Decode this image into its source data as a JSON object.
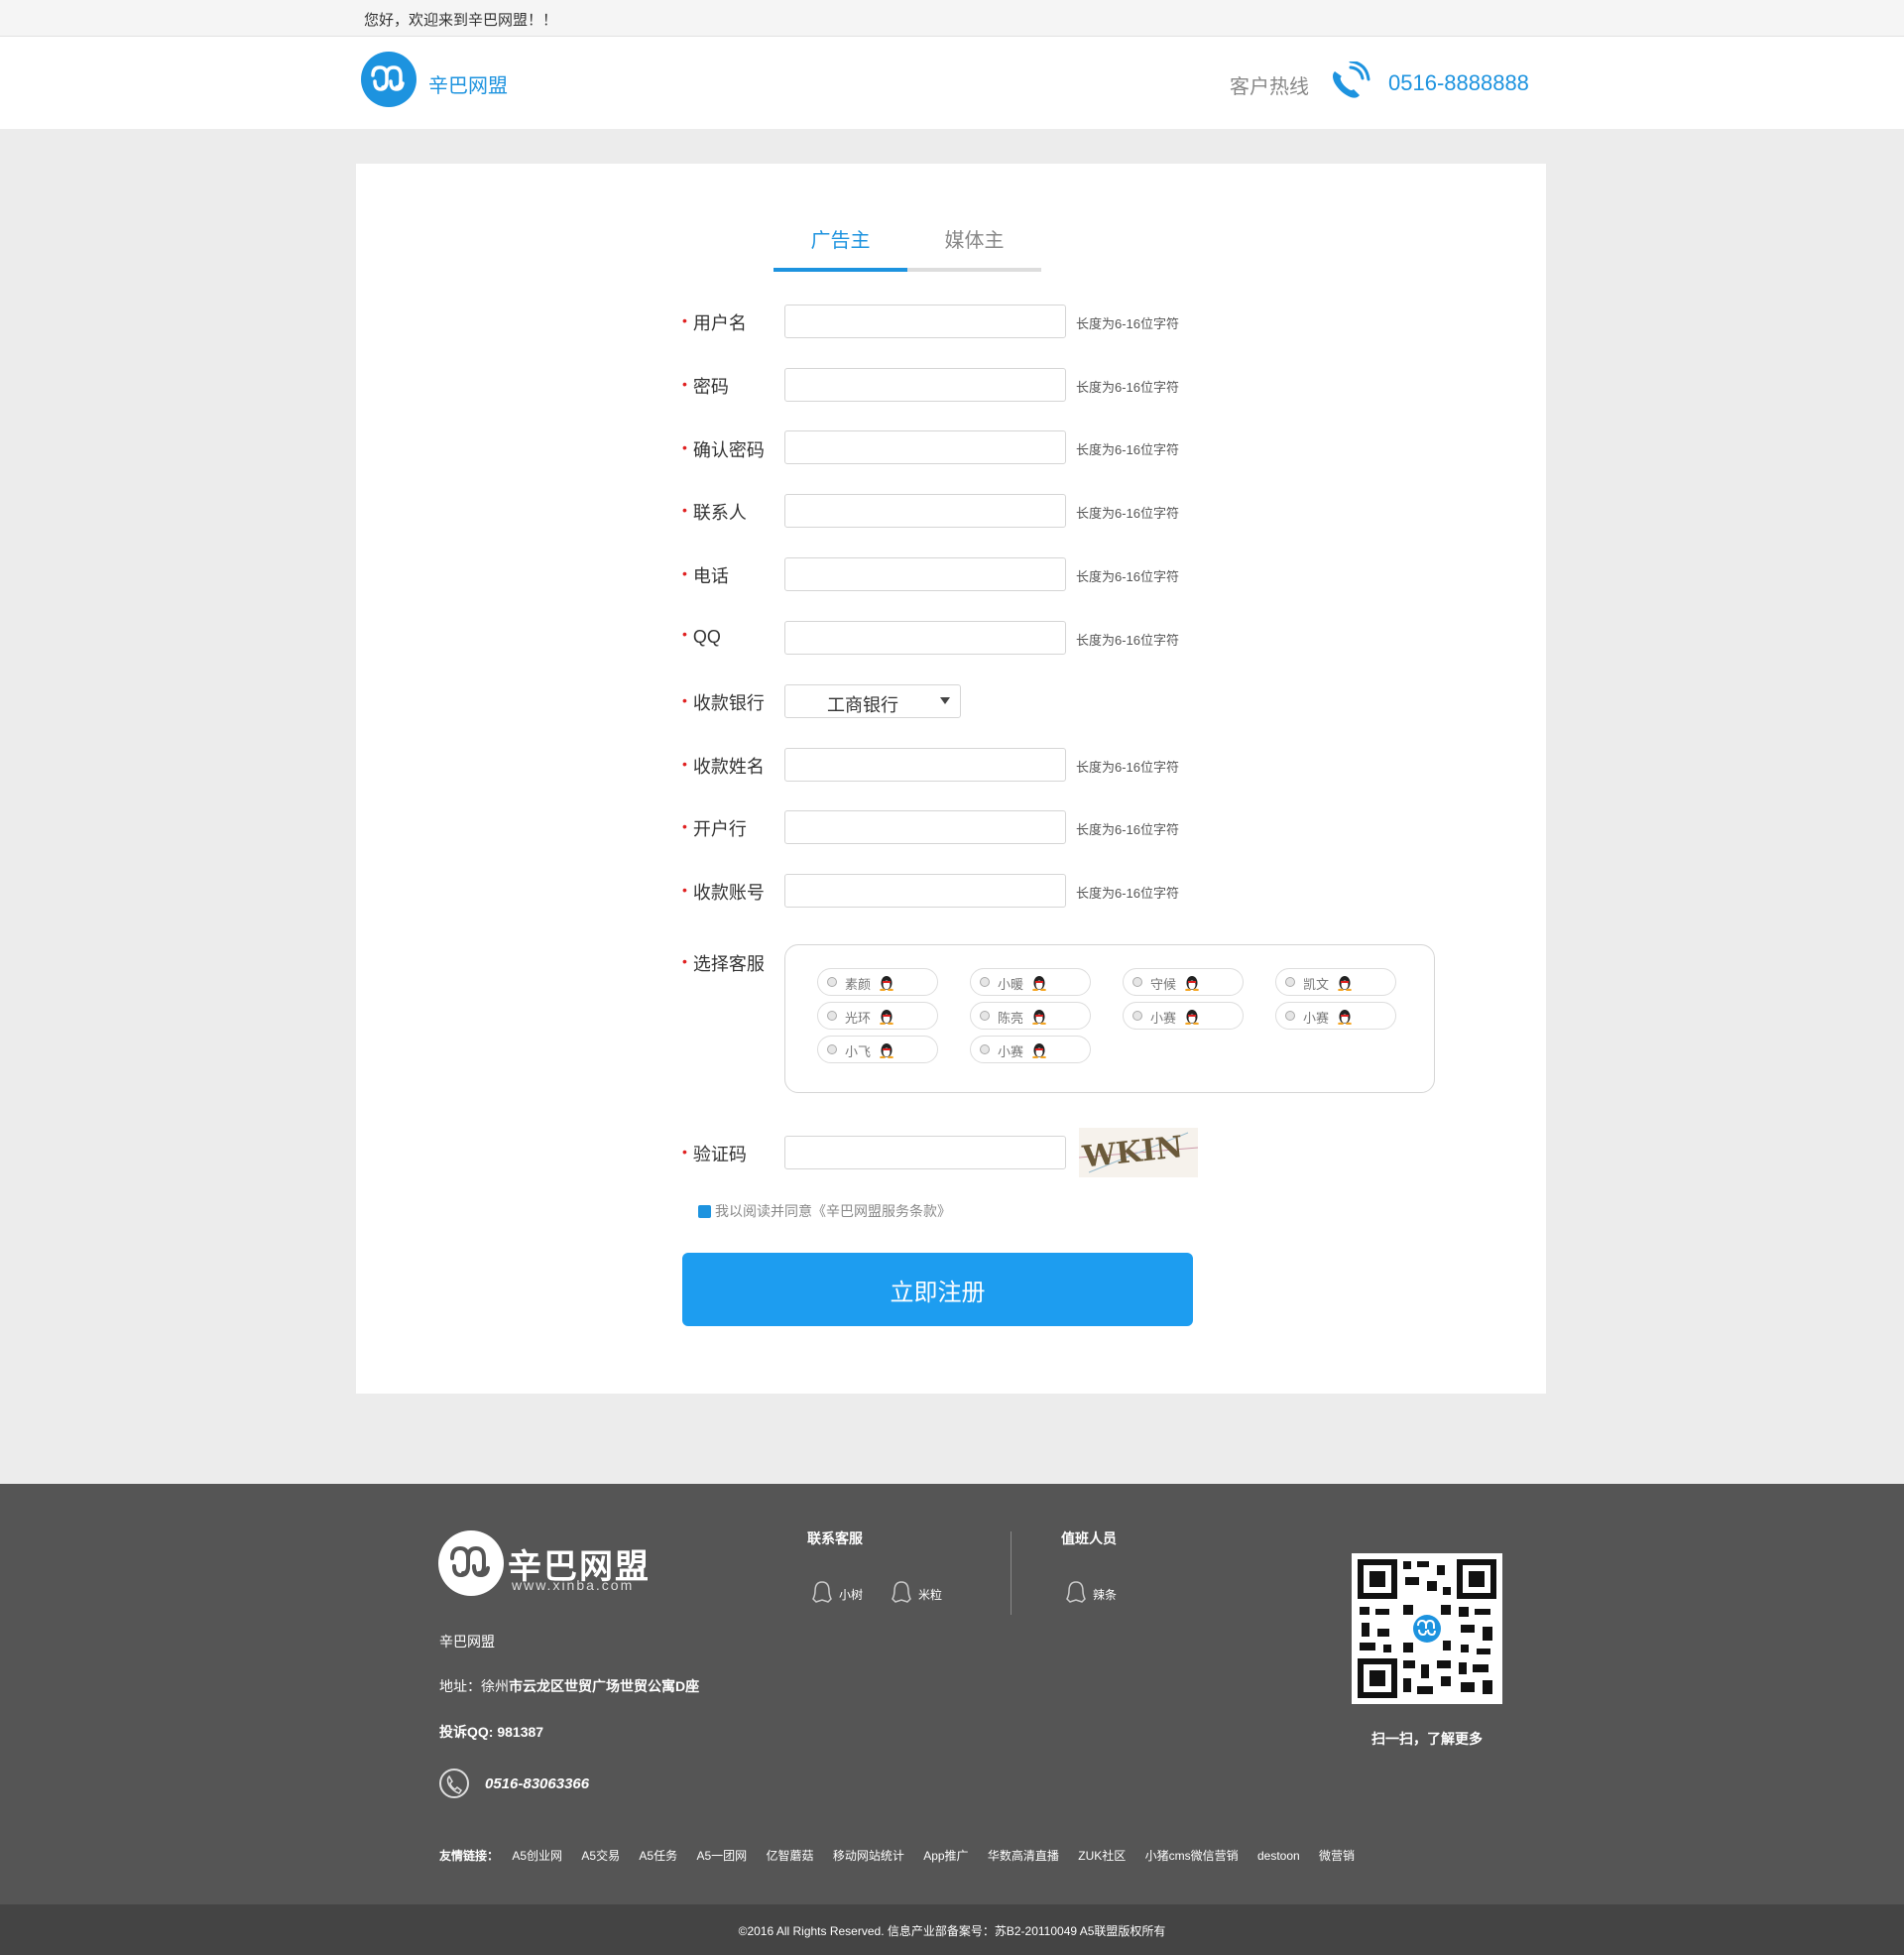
{
  "topbar": {
    "greeting": "您好，欢迎来到辛巴网盟！！"
  },
  "header": {
    "brand": "辛巴网盟",
    "hotline_label": "客户热线",
    "hotline_number": "0516-8888888",
    "accent_color": "#1d93df"
  },
  "tabs": [
    {
      "label": "广告主",
      "active": true
    },
    {
      "label": "媒体主",
      "active": false
    }
  ],
  "form": {
    "fields": [
      {
        "label": "用户名",
        "value": "",
        "hint": "长度为6-16位字符"
      },
      {
        "label": "密码",
        "value": "",
        "hint": "长度为6-16位字符"
      },
      {
        "label": "确认密码",
        "value": "",
        "hint": "长度为6-16位字符"
      },
      {
        "label": "联系人",
        "value": "",
        "hint": "长度为6-16位字符"
      },
      {
        "label": "电话",
        "value": "",
        "hint": "长度为6-16位字符"
      },
      {
        "label": "QQ",
        "value": "",
        "hint": "长度为6-16位字符"
      },
      {
        "label": "收款姓名",
        "value": "",
        "hint": "长度为6-16位字符"
      },
      {
        "label": "开户行",
        "value": "",
        "hint": "长度为6-16位字符"
      },
      {
        "label": "收款账号",
        "value": "",
        "hint": "长度为6-16位字符"
      }
    ],
    "bank": {
      "label": "收款银行",
      "selected": "工商银行"
    },
    "customer_service": {
      "label": "选择客服",
      "options": [
        "素颜",
        "小暖",
        "守候",
        "凯文",
        "光环",
        "陈亮",
        "小赛",
        "小赛",
        "小飞",
        "小赛"
      ]
    },
    "captcha": {
      "label": "验证码",
      "value": "",
      "image_text": "WKIN"
    },
    "agreement": "我以阅读并同意《辛巴网盟服务条款》",
    "submit_label": "立即注册",
    "required_mark": "•"
  },
  "footer": {
    "brand_big": "辛巴网盟",
    "brand_url": "www.xinba.com",
    "company": "辛巴网盟",
    "address_prefix": "地址：徐州",
    "address_rest": "市云龙区世贸广场世贸公寓D座",
    "complaint_qq": "投诉QQ: 981387",
    "phone": "0516-83063366",
    "contact_title": "联系客服",
    "contacts": [
      "小树",
      "米粒"
    ],
    "duty_title": "值班人员",
    "duty": [
      "辣条"
    ],
    "qr_caption": "扫一扫，了解更多",
    "links_label": "友情链接：",
    "links": [
      "A5创业网",
      "A5交易",
      "A5任务",
      "A5一团网",
      "亿智蘑菇",
      "移动网站统计",
      "App推广",
      "华数高清直播",
      "ZUK社区",
      "小猪cms微信营销",
      "destoon",
      "微营销"
    ],
    "copyright": "©2016 All Rights Reserved.   信息产业部备案号：苏B2-20110049   A5联盟版权所有"
  }
}
